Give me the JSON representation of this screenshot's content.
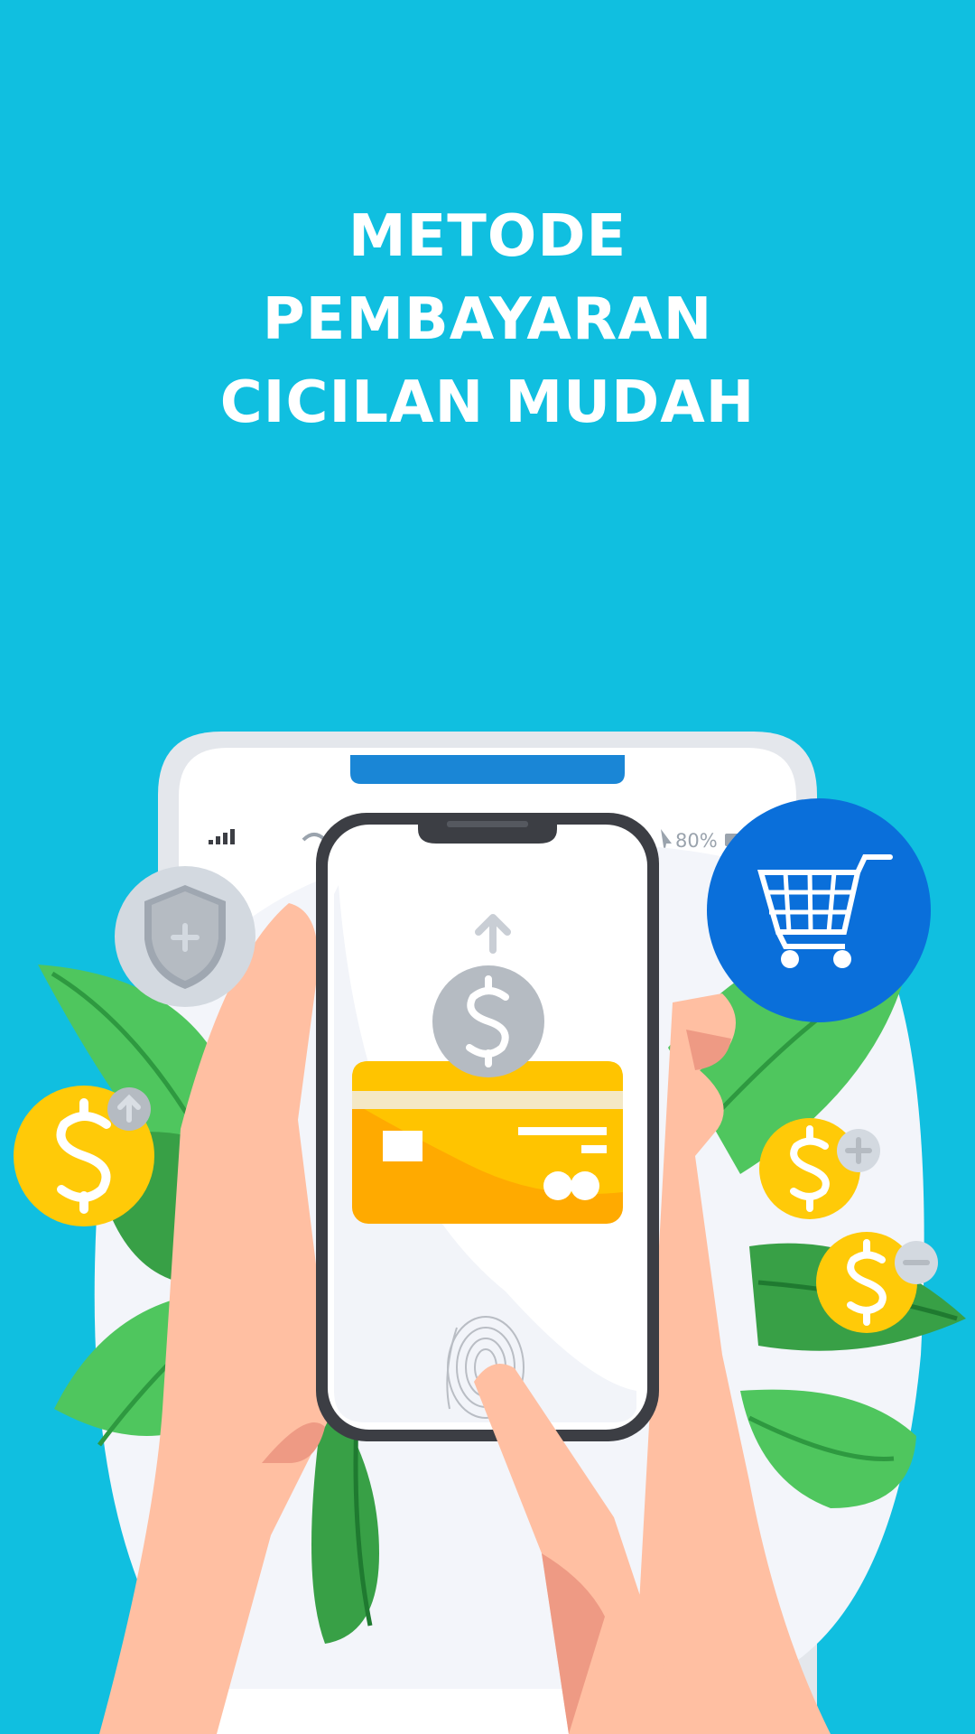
{
  "screen": {
    "background_color": "#10BFE0"
  },
  "headline": {
    "line1": "METODE",
    "line2": "PEMBAYARAN",
    "line3": "CICILAN MUDAH",
    "color": "#FFFFFF"
  },
  "illustration": {
    "status_battery": "80%",
    "icons": [
      "back-phone",
      "front-phone",
      "hand-holding-phone",
      "finger-touching-fingerprint",
      "fingerprint-icon",
      "credit-card",
      "dollar-coin-up-arrow-icon",
      "shield-plus-icon",
      "shopping-cart-icon",
      "dollar-coin-up-icon",
      "dollar-coin-plus-icon",
      "dollar-coin-minus-icon",
      "green-leaves"
    ],
    "colors": {
      "cart_circle": "#0A6FDA",
      "coin_yellow": "#FFCA08",
      "card_orange": "#FFAA00",
      "coin_gray": "#B5BBC2",
      "skin": "#FFBFA2",
      "skin_shadow": "#EE9A84",
      "leaf_light": "#4FC65E",
      "leaf_dark": "#38A046",
      "phone_frame": "#3C3E44"
    }
  }
}
